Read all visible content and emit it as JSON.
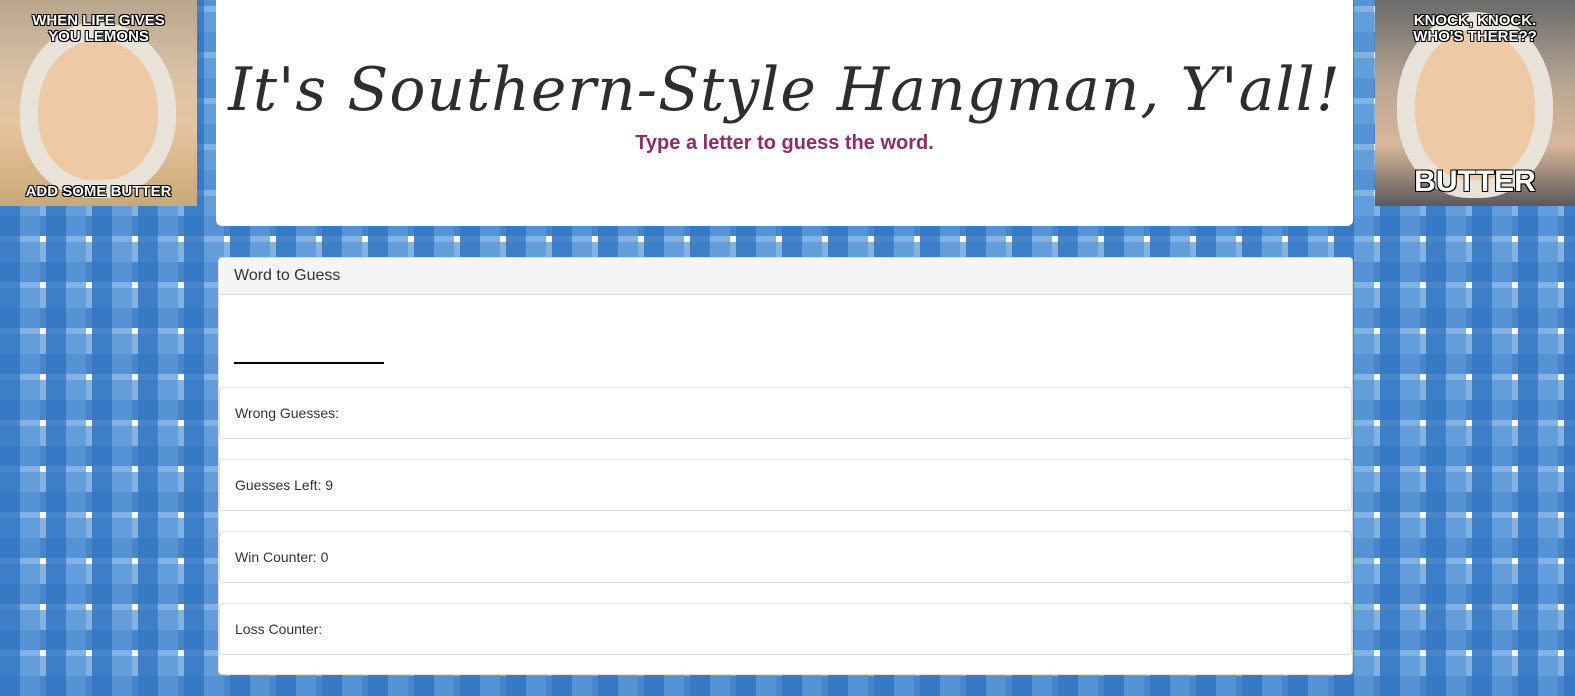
{
  "memes": {
    "left": {
      "top_caption": "WHEN LIFE GIVES\nYOU LEMONS",
      "bottom_caption": "ADD SOME BUTTER"
    },
    "right": {
      "top_caption": "KNOCK, KNOCK.\nWHO'S THERE??",
      "bottom_caption": "BUTTER"
    }
  },
  "header": {
    "title": "It's Southern-Style Hangman, Y'all!",
    "subtitle": "Type a letter to guess the word."
  },
  "panel": {
    "heading": "Word to Guess",
    "wrong_guesses": "Wrong Guesses:",
    "guesses_left": "Guesses Left: 9",
    "win_counter": "Win Counter: 0",
    "loss_counter": "Loss Counter:"
  },
  "colors": {
    "subtitle": "#8e2c6c",
    "gingham_blue": "#3478c4"
  }
}
